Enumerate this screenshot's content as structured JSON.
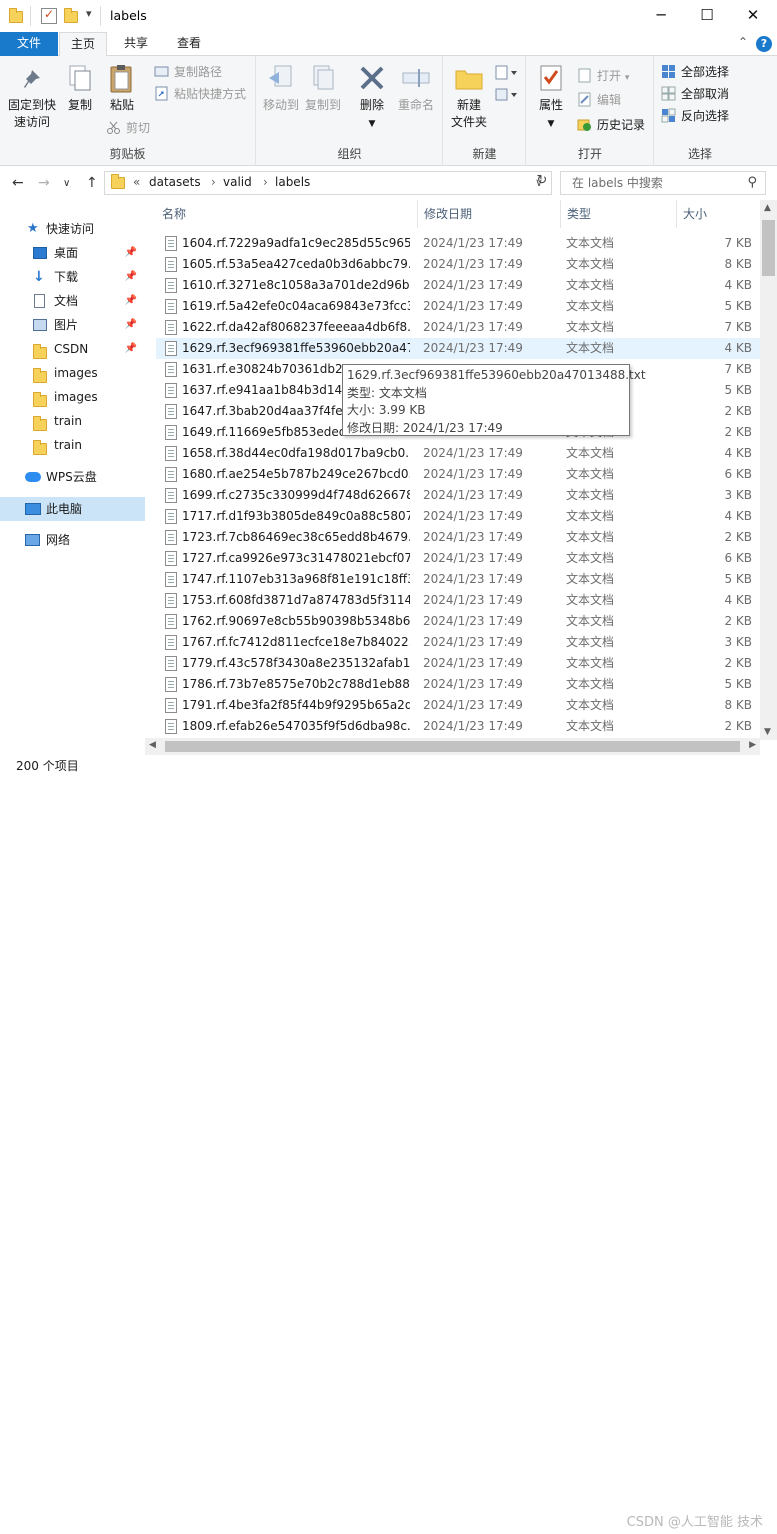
{
  "window": {
    "title": "labels",
    "minimize_glyph": "─",
    "maximize_glyph": "☐",
    "close_glyph": "✕",
    "qat_dropdown_glyph": "▾"
  },
  "menubar": {
    "file": "文件",
    "home": "主页",
    "share": "共享",
    "view": "查看",
    "collapse_glyph": "⌃",
    "help_glyph": "?"
  },
  "ribbon": {
    "clipboard": {
      "group_label": "剪贴板",
      "pin_quick_access_line1": "固定到快",
      "pin_quick_access_line2": "速访问",
      "copy": "复制",
      "paste": "粘贴",
      "copy_path": "复制路径",
      "paste_shortcut": "粘贴快捷方式",
      "cut": "剪切"
    },
    "organize": {
      "group_label": "组织",
      "move_to": "移动到",
      "copy_to": "复制到",
      "delete": "删除",
      "rename": "重命名"
    },
    "new": {
      "group_label": "新建",
      "new_folder_line1": "新建",
      "new_folder_line2": "文件夹"
    },
    "open": {
      "group_label": "打开",
      "properties": "属性",
      "open": "打开",
      "edit": "编辑",
      "history": "历史记录"
    },
    "select": {
      "group_label": "选择",
      "select_all": "全部选择",
      "select_none": "全部取消",
      "invert": "反向选择"
    }
  },
  "address": {
    "overflow": "«",
    "crumbs": [
      "datasets",
      "valid",
      "labels"
    ],
    "separator": "›",
    "search_placeholder": "在 labels 中搜索"
  },
  "nav": {
    "quick_access": "快速访问",
    "items": [
      {
        "label": "桌面",
        "pinned": true
      },
      {
        "label": "下载",
        "pinned": true
      },
      {
        "label": "文档",
        "pinned": true
      },
      {
        "label": "图片",
        "pinned": true
      },
      {
        "label": "CSDN",
        "pinned": true
      },
      {
        "label": "images",
        "pinned": false
      },
      {
        "label": "images",
        "pinned": false
      },
      {
        "label": "train",
        "pinned": false
      },
      {
        "label": "train",
        "pinned": false
      }
    ],
    "wps_cloud": "WPS云盘",
    "this_pc": "此电脑",
    "network": "网络"
  },
  "columns": {
    "name": "名称",
    "date": "修改日期",
    "type": "类型",
    "size": "大小"
  },
  "files": [
    {
      "name": "1604.rf.7229a9adfa1c9ec285d55c965...",
      "date": "2024/1/23 17:49",
      "type": "文本文档",
      "size": "7 KB"
    },
    {
      "name": "1605.rf.53a5ea427ceda0b3d6abbc79...",
      "date": "2024/1/23 17:49",
      "type": "文本文档",
      "size": "8 KB"
    },
    {
      "name": "1610.rf.3271e8c1058a3a701de2d96b...",
      "date": "2024/1/23 17:49",
      "type": "文本文档",
      "size": "4 KB"
    },
    {
      "name": "1619.rf.5a42efe0c04aca69843e73fcc3...",
      "date": "2024/1/23 17:49",
      "type": "文本文档",
      "size": "5 KB"
    },
    {
      "name": "1622.rf.da42af8068237feeeaa4db6f8...",
      "date": "2024/1/23 17:49",
      "type": "文本文档",
      "size": "7 KB"
    },
    {
      "name": "1629.rf.3ecf969381ffe53960ebb20a47...",
      "date": "2024/1/23 17:49",
      "type": "文本文档",
      "size": "4 KB"
    },
    {
      "name": "1631.rf.e30824b70361db2a",
      "date": "",
      "type": "",
      "size": "7 KB"
    },
    {
      "name": "1637.rf.e941aa1b84b3d14c",
      "date": "",
      "type": "",
      "size": "5 KB"
    },
    {
      "name": "1647.rf.3bab20d4aa37f4fe9",
      "date": "",
      "type": "",
      "size": "2 KB"
    },
    {
      "name": "1649.rf.11669e5fb853ededb",
      "date": "",
      "type": "文本文档",
      "size": "2 KB"
    },
    {
      "name": "1658.rf.38d44ec0dfa198d017ba9cb0...",
      "date": "2024/1/23 17:49",
      "type": "文本文档",
      "size": "4 KB"
    },
    {
      "name": "1680.rf.ae254e5b787b249ce267bcd0...",
      "date": "2024/1/23 17:49",
      "type": "文本文档",
      "size": "6 KB"
    },
    {
      "name": "1699.rf.c2735c330999d4f748d626678...",
      "date": "2024/1/23 17:49",
      "type": "文本文档",
      "size": "3 KB"
    },
    {
      "name": "1717.rf.d1f93b3805de849c0a88c5807...",
      "date": "2024/1/23 17:49",
      "type": "文本文档",
      "size": "4 KB"
    },
    {
      "name": "1723.rf.7cb86469ec38c65edd8b4679...",
      "date": "2024/1/23 17:49",
      "type": "文本文档",
      "size": "2 KB"
    },
    {
      "name": "1727.rf.ca9926e973c31478021ebcf07...",
      "date": "2024/1/23 17:49",
      "type": "文本文档",
      "size": "6 KB"
    },
    {
      "name": "1747.rf.1107eb313a968f81e191c18ff3...",
      "date": "2024/1/23 17:49",
      "type": "文本文档",
      "size": "5 KB"
    },
    {
      "name": "1753.rf.608fd3871d7a874783d5f3114...",
      "date": "2024/1/23 17:49",
      "type": "文本文档",
      "size": "4 KB"
    },
    {
      "name": "1762.rf.90697e8cb55b90398b5348b6...",
      "date": "2024/1/23 17:49",
      "type": "文本文档",
      "size": "2 KB"
    },
    {
      "name": "1767.rf.fc7412d811ecfce18e7b84022...",
      "date": "2024/1/23 17:49",
      "type": "文本文档",
      "size": "3 KB"
    },
    {
      "name": "1779.rf.43c578f3430a8e235132afab1...",
      "date": "2024/1/23 17:49",
      "type": "文本文档",
      "size": "2 KB"
    },
    {
      "name": "1786.rf.73b7e8575e70b2c788d1eb88...",
      "date": "2024/1/23 17:49",
      "type": "文本文档",
      "size": "5 KB"
    },
    {
      "name": "1791.rf.4be3fa2f85f44b9f9295b65a2d...",
      "date": "2024/1/23 17:49",
      "type": "文本文档",
      "size": "8 KB"
    },
    {
      "name": "1809.rf.efab26e547035f9f5d6dba98c...",
      "date": "2024/1/23 17:49",
      "type": "文本文档",
      "size": "2 KB"
    }
  ],
  "tooltip": {
    "filename": "1629.rf.3ecf969381ffe53960ebb20a47013488.txt",
    "type_line": "类型: 文本文档",
    "size_line": "大小: 3.99 KB",
    "date_line": "修改日期: 2024/1/23 17:49"
  },
  "status": {
    "item_count": "200 个项目"
  },
  "watermark": "CSDN @人工智能 技术",
  "colors": {
    "accent": "#1979ca",
    "selection": "#e5f3ff",
    "folder": "#f7d25b"
  }
}
